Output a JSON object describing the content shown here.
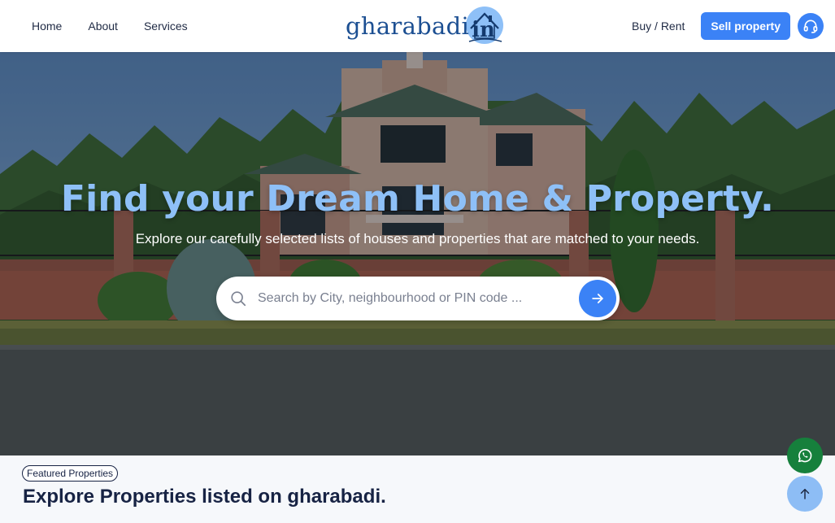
{
  "header": {
    "nav_left": [
      "Home",
      "About",
      "Services"
    ],
    "logo": {
      "text": "gharabadi",
      "suffix": "in"
    },
    "buy_rent": "Buy / Rent",
    "sell_button": "Sell property",
    "support_icon": "headset-icon"
  },
  "hero": {
    "title": "Find your Dream Home & Property.",
    "subtitle": "Explore our carefully selected lists of houses and properties that are matched to your needs.",
    "search": {
      "placeholder": "Search by City, neighbourhood or PIN code ...",
      "value": "",
      "search_icon": "search-icon",
      "submit_icon": "arrow-right-icon"
    }
  },
  "featured": {
    "badge": "Featured Properties",
    "title": "Explore Properties listed on gharabadi."
  },
  "floating": {
    "whatsapp_icon": "whatsapp-icon",
    "scroll_top_icon": "arrow-up-icon"
  },
  "colors": {
    "accent": "#3b82f6",
    "hero_title": "#8ec0f7",
    "dark_text": "#172344",
    "whatsapp": "#16803c",
    "scroll_top": "#8dbdf5"
  }
}
